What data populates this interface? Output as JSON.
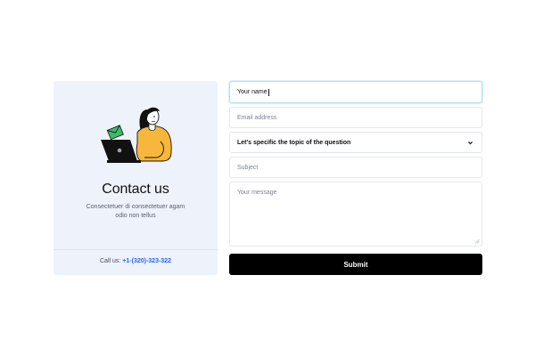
{
  "contact": {
    "title": "Contact us",
    "description": "Consectetuer di consectetuer agam odio non tellus",
    "call_label": "Call us:",
    "phone": "+1-(320)-323-322"
  },
  "form": {
    "name_value": "Your name",
    "email_placeholder": "Email address",
    "topic_selected": "Let's specific the topic of the question",
    "subject_placeholder": "Subject",
    "message_placeholder": "Your message",
    "submit_label": "Submit"
  },
  "colors": {
    "accent": "#2563eb",
    "card_bg": "#eef2fb",
    "submit_bg": "#000000",
    "illustration_sweater": "#f6b73c",
    "illustration_envelope": "#3dbb6b"
  },
  "icons": {
    "illustration": "person-with-laptop-illustration",
    "topic_dropdown": "chevron-down-icon",
    "resize": "resize-grip-icon"
  }
}
